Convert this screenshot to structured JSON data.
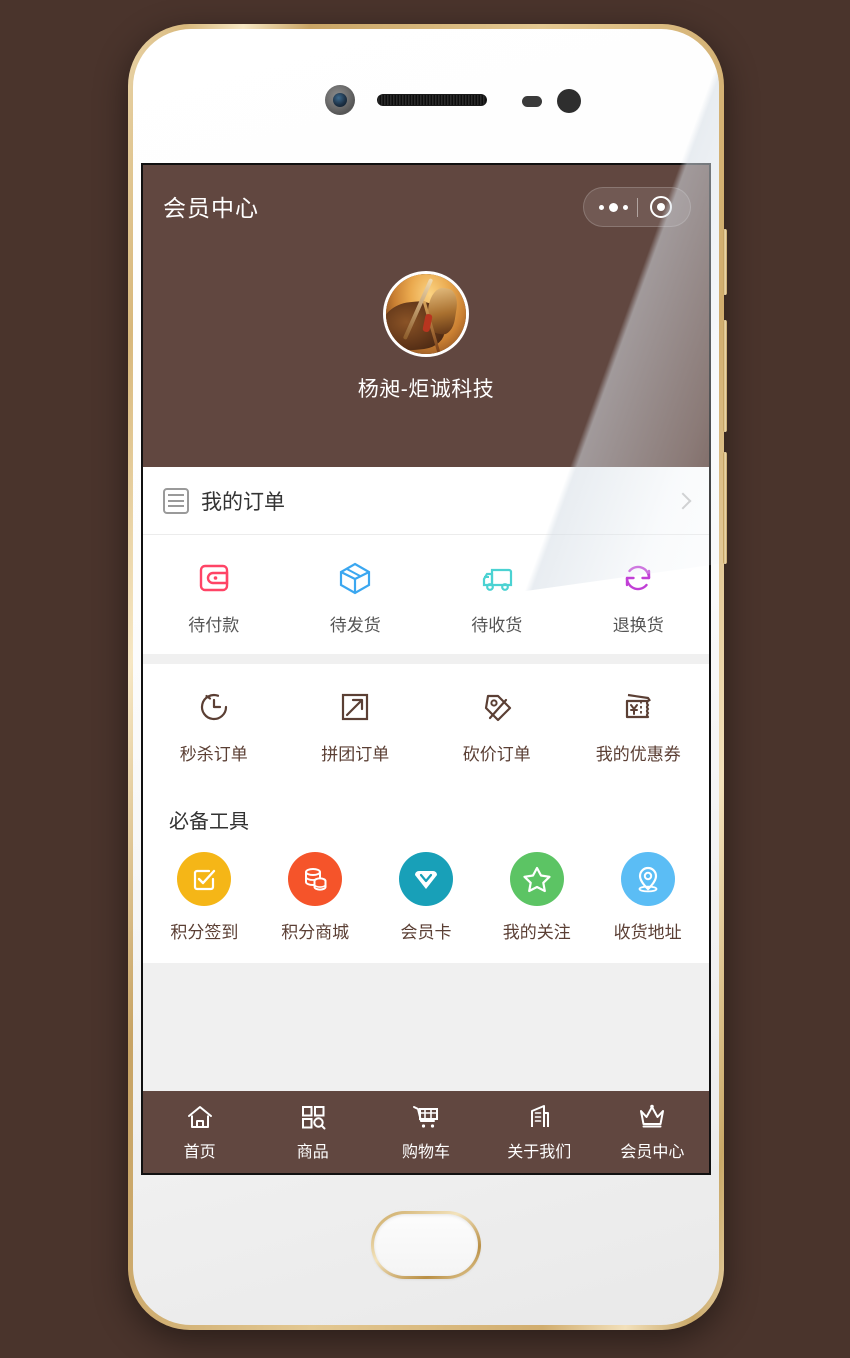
{
  "theme": {
    "page_background": "#4a342c",
    "header_brown": "#614740",
    "card_white": "#ffffff",
    "gap_gray": "#f0f0f0",
    "tabbar_brown": "#614740"
  },
  "navbar": {
    "title": "会员中心",
    "capsule": {
      "more_icon": "ellipsis-icon",
      "target_icon": "target-icon"
    }
  },
  "profile": {
    "avatar_icon": "user-avatar",
    "username": "杨昶-炬诚科技"
  },
  "orders": {
    "section_title": "我的订单",
    "section_icon": "order-list-icon",
    "chevron_icon": "chevron-right-icon",
    "statuses": [
      {
        "label": "待付款",
        "icon": "wallet-icon",
        "color": "#ff4466"
      },
      {
        "label": "待发货",
        "icon": "box-icon",
        "color": "#3ba7f0"
      },
      {
        "label": "待收货",
        "icon": "truck-icon",
        "color": "#4bd2d2"
      },
      {
        "label": "退换货",
        "icon": "refresh-icon",
        "color": "#c13fd6"
      }
    ],
    "types": [
      {
        "label": "秒杀订单",
        "icon": "alarm-clock-icon",
        "color": "#5b3f34"
      },
      {
        "label": "拼团订单",
        "icon": "group-arrow-icon",
        "color": "#5b3f34"
      },
      {
        "label": "砍价订单",
        "icon": "price-tag-icon",
        "color": "#5b3f34"
      },
      {
        "label": "我的优惠券",
        "icon": "coupon-icon",
        "color": "#5b3f34"
      }
    ]
  },
  "tools": {
    "title": "必备工具",
    "items": [
      {
        "label": "积分签到",
        "icon": "checkbox-icon",
        "color": "#f5b617"
      },
      {
        "label": "积分商城",
        "icon": "coins-icon",
        "color": "#f5542a"
      },
      {
        "label": "会员卡",
        "icon": "diamond-icon",
        "color": "#18a0b8"
      },
      {
        "label": "我的关注",
        "icon": "star-icon",
        "color": "#5cc464"
      },
      {
        "label": "收货地址",
        "icon": "location-icon",
        "color": "#5bbdf5"
      }
    ]
  },
  "tabbar": {
    "items": [
      {
        "label": "首页",
        "icon": "home-icon"
      },
      {
        "label": "商品",
        "icon": "grid-search-icon"
      },
      {
        "label": "购物车",
        "icon": "cart-icon"
      },
      {
        "label": "关于我们",
        "icon": "building-icon"
      },
      {
        "label": "会员中心",
        "icon": "crown-icon"
      }
    ]
  },
  "device": {
    "camera_icon": "front-camera",
    "speaker_icon": "earpiece-speaker",
    "sensor_icon": "proximity-sensor",
    "home_button_icon": "home-button"
  }
}
